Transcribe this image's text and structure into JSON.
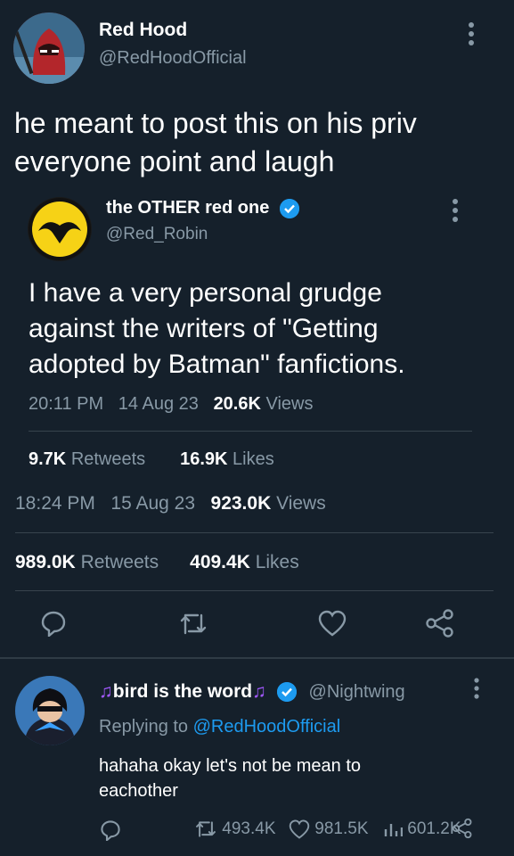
{
  "main_tweet": {
    "display_name": "Red Hood",
    "handle": "@RedHoodOfficial",
    "text_line1": "he meant to post this on his priv",
    "text_line2": "everyone point and laugh",
    "quoted": {
      "display_name": "the OTHER red one",
      "handle": "@Red_Robin",
      "text_line1": "I have a very personal grudge",
      "text_line2": "against the writers of \"Getting",
      "text_line3": "adopted by Batman\" fanfictions.",
      "time": "20:11 PM",
      "date": "14 Aug 23",
      "views_count": "20.6K",
      "views_label": "Views",
      "retweets_count": "9.7K",
      "retweets_label": "Retweets",
      "likes_count": "16.9K",
      "likes_label": "Likes"
    },
    "time": "18:24 PM",
    "date": "15 Aug 23",
    "views_count": "923.0K",
    "views_label": "Views",
    "retweets_count": "989.0K",
    "retweets_label": "Retweets",
    "likes_count": "409.4K",
    "likes_label": "Likes"
  },
  "reply": {
    "name_text": "bird is the word",
    "note_symbol": "♫",
    "handle": "@Nightwing",
    "replying_prefix": "Replying to",
    "replying_handle": "@RedHoodOfficial",
    "text_line1": "hahaha okay let's not be mean to",
    "text_line2": "eachother",
    "retweets": "493.4K",
    "likes": "981.5K",
    "views": "601.2K"
  },
  "colors": {
    "background": "#15202b",
    "accent": "#1d9bf0",
    "muted": "#8899a6",
    "divider": "#38444d"
  },
  "icons": [
    "more-icon",
    "verified-icon",
    "reply-icon",
    "retweet-icon",
    "like-icon",
    "share-icon",
    "views-icon"
  ]
}
